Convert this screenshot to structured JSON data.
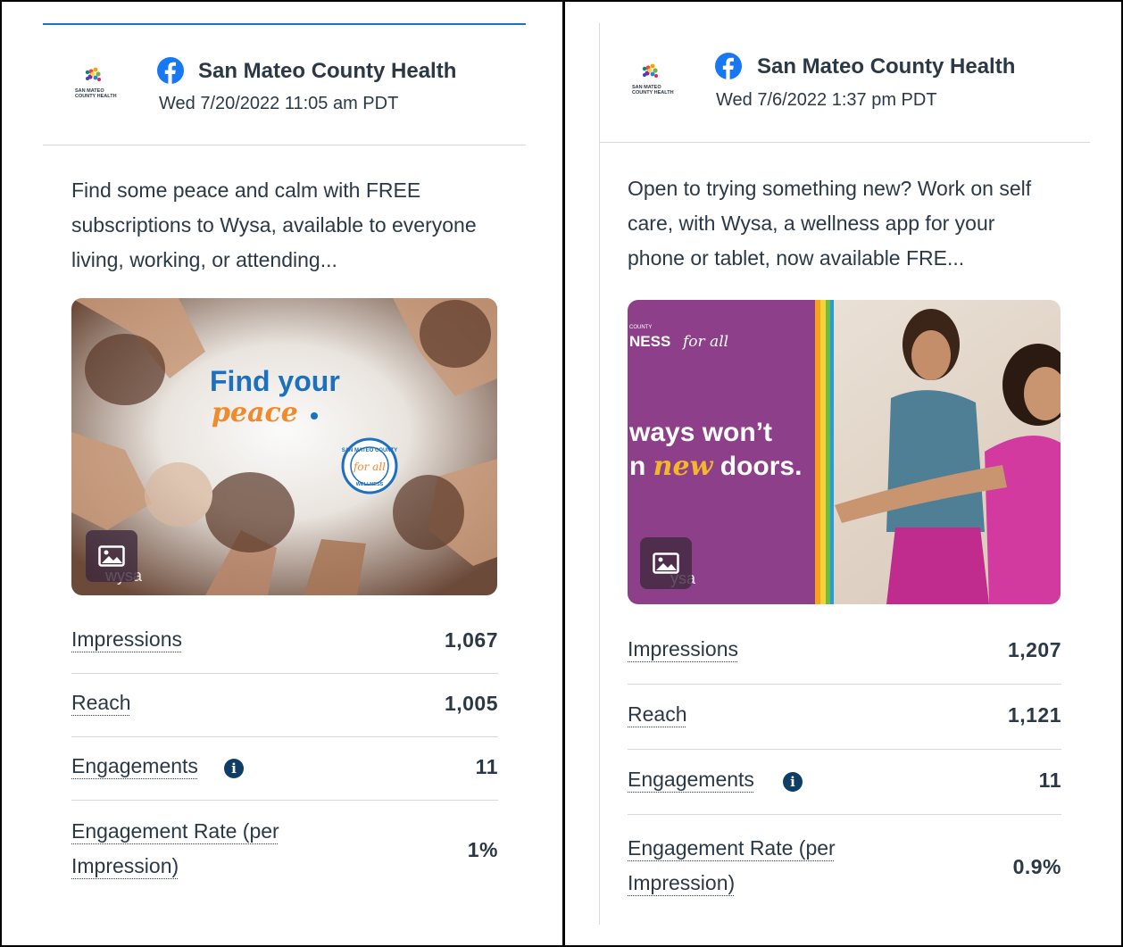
{
  "posts": [
    {
      "account": "San Mateo County Health",
      "logo_text": [
        "SAN MATEO",
        "COUNTY HEALTH"
      ],
      "date": "Wed 7/20/2022 11:05 am PDT",
      "text": "Find some peace and calm with FREE subscriptions to Wysa, available to everyone living, working, or attending...",
      "image": {
        "headline_line1": "Find your",
        "headline_line2": "peace",
        "seal_top": "SAN MATEO COUNTY",
        "seal_middle": "for all",
        "seal_bottom": "WELLNESS",
        "watermark": "wysa"
      },
      "metrics": [
        {
          "label": "Impressions",
          "value": "1,067"
        },
        {
          "label": "Reach",
          "value": "1,005"
        },
        {
          "label": "Engagements",
          "value": "11",
          "info": true
        },
        {
          "label": "Engagement Rate (per Impression)",
          "value": "1%"
        }
      ]
    },
    {
      "account": "San Mateo County Health",
      "logo_text": [
        "SAN MATEO",
        "COUNTY HEALTH"
      ],
      "date": "Wed 7/6/2022 1:37 pm PDT",
      "text": "Open to trying something new? Work on self care, with Wysa, a wellness app for your phone or tablet, now available FRE...",
      "image": {
        "small": "COUNTY",
        "brand": "NESS",
        "brand_script": "for all",
        "line1": "ways won’t",
        "line2_a": "n ",
        "line2_b": "new",
        "line2_c": " doors.",
        "watermark": "ysa"
      },
      "metrics": [
        {
          "label": "Impressions",
          "value": "1,207"
        },
        {
          "label": "Reach",
          "value": "1,121"
        },
        {
          "label": "Engagements",
          "value": "11",
          "info": true
        },
        {
          "label": "Engagement Rate (per Impression)",
          "value": "0.9%"
        }
      ]
    }
  ],
  "info_glyph": "i",
  "colors": {
    "accent": "#1a73c9",
    "text": "#2b3846",
    "facebook": "#1877f2",
    "info": "#0e3e66",
    "peace_orange": "#f08a2c",
    "headline_blue": "#1d6fbf",
    "purple_panel": "#8e3f8a"
  }
}
